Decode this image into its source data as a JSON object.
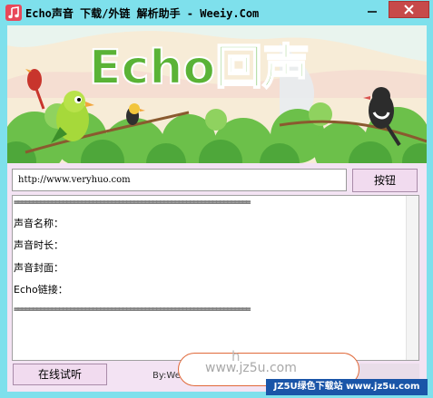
{
  "window": {
    "title": "Echo声音 下载/外链 解析助手 - Weeiy.Com",
    "minimize_label": "—",
    "close_label": "✕"
  },
  "banner": {
    "logo_text": "Echo回声"
  },
  "toolbar": {
    "url_value": "http://www.veryhuo.com",
    "go_button_label": "按钮"
  },
  "output": {
    "separator": "===============================================================",
    "lines": [
      "声音名称：",
      "声音时长：",
      "声音封面：",
      "Echo链接："
    ]
  },
  "footer": {
    "trial_button_label": "在线试听",
    "credit_text": "By:We",
    "watermark_text": "www.jz5u.com",
    "watermark_h": "h",
    "badge_text": "JZ5U绿色下载站 www.jz5u.com"
  },
  "colors": {
    "frame": "#7ee0ec",
    "client_bg": "#f3e3f3",
    "logo_green": "#5ab336",
    "close_red": "#c74a4a",
    "badge_blue": "#1a55a8"
  }
}
